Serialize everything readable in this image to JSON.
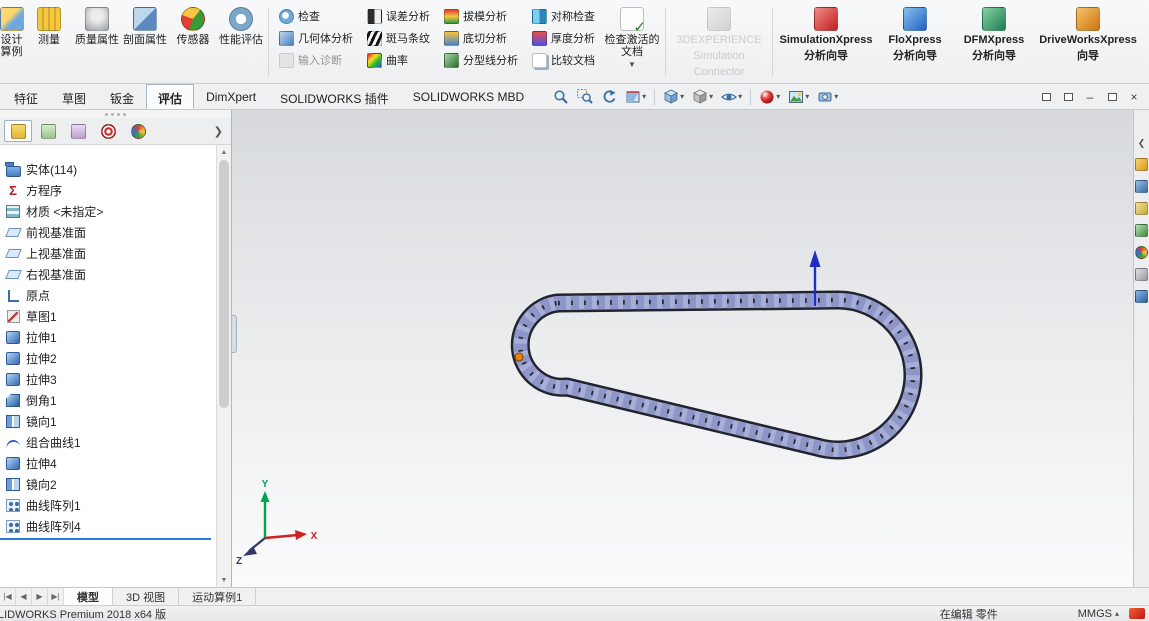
{
  "ribbon": {
    "big_buttons": [
      {
        "label": "设计算例"
      },
      {
        "label": "测量"
      },
      {
        "label": "质量属性"
      },
      {
        "label": "剖面属性"
      },
      {
        "label": "传感器"
      },
      {
        "label": "性能评估"
      }
    ],
    "small_buttons": {
      "col1": [
        "检查",
        "几何体分析",
        "输入诊断"
      ],
      "col2": [
        "误差分析",
        "斑马条纹",
        "曲率"
      ],
      "col3": [
        "拔模分析",
        "底切分析",
        "分型线分析"
      ],
      "col4": [
        "对称检查",
        "厚度分析",
        "比较文档"
      ]
    },
    "check_active_doc": "检查激活的文档",
    "xpress": [
      {
        "lines": [
          "3DEXPERIENCE",
          "Simulation",
          "Connector"
        ]
      },
      {
        "lines": [
          "SimulationXpress",
          "分析向导"
        ]
      },
      {
        "lines": [
          "FloXpress",
          "分析向导"
        ]
      },
      {
        "lines": [
          "DFMXpress",
          "分析向导"
        ]
      },
      {
        "lines": [
          "DriveWorksXpress",
          "向导"
        ]
      }
    ]
  },
  "tab_bar": {
    "tabs": [
      "特征",
      "草图",
      "钣金",
      "评估",
      "DimXpert",
      "SOLIDWORKS 插件",
      "SOLIDWORKS MBD"
    ],
    "active": "评估",
    "headsup_icons": [
      "zoom-fit",
      "zoom-area",
      "previous-view",
      "section-view",
      "view-orientation",
      "display-style",
      "hide-show-items",
      "edit-appearance",
      "apply-scene",
      "view-settings"
    ]
  },
  "left_panel": {
    "tab_icons": [
      "featuremanager",
      "propertymanager",
      "configurationmanager",
      "dimxpertmanager",
      "displaymanager"
    ]
  },
  "feature_tree": {
    "items": [
      {
        "label": "实体(114)",
        "icon": "solid-bodies-folder-icon"
      },
      {
        "label": "方程序",
        "icon": "equations-icon"
      },
      {
        "label": "材质 <未指定>",
        "icon": "material-icon"
      },
      {
        "label": "前视基准面",
        "icon": "plane-icon"
      },
      {
        "label": "上视基准面",
        "icon": "plane-icon"
      },
      {
        "label": "右视基准面",
        "icon": "plane-icon"
      },
      {
        "label": "原点",
        "icon": "origin-icon"
      },
      {
        "label": "草图1",
        "icon": "sketch-icon"
      },
      {
        "label": "拉伸1",
        "icon": "extrude-icon"
      },
      {
        "label": "拉伸2",
        "icon": "extrude-icon"
      },
      {
        "label": "拉伸3",
        "icon": "extrude-icon"
      },
      {
        "label": "倒角1",
        "icon": "chamfer-icon"
      },
      {
        "label": "镜向1",
        "icon": "mirror-icon"
      },
      {
        "label": "组合曲线1",
        "icon": "composite-curve-icon"
      },
      {
        "label": "拉伸4",
        "icon": "extrude-icon"
      },
      {
        "label": "镜向2",
        "icon": "mirror-icon"
      },
      {
        "label": "曲线阵列1",
        "icon": "curve-pattern-icon"
      },
      {
        "label": "曲线阵列4",
        "icon": "curve-pattern-icon"
      }
    ]
  },
  "viewport": {
    "model": "roller-chain-loop",
    "triad": {
      "x": "X",
      "y": "Y",
      "z": "Z"
    },
    "colors": {
      "chain_body": "#a7aed8",
      "chain_outline": "#23232e",
      "arrow_blue": "#1f2ec4",
      "marker_orange": "#f08000",
      "triad_x": "#cc2222",
      "triad_y": "#00a550",
      "triad_z": "#333a66"
    }
  },
  "taskpane": {
    "icons": [
      "taskpane-resources",
      "taskpane-design-library",
      "taskpane-file-explorer",
      "taskpane-view-palette",
      "taskpane-appearances",
      "taskpane-custom-properties",
      "taskpane-forum"
    ]
  },
  "bottom_tabs": {
    "tabs": [
      "模型",
      "3D 视图",
      "运动算例1"
    ],
    "active": "模型"
  },
  "status_bar": {
    "left": "LIDWORKS Premium 2018 x64 版",
    "editing": "在编辑 零件",
    "units": "MMGS"
  }
}
